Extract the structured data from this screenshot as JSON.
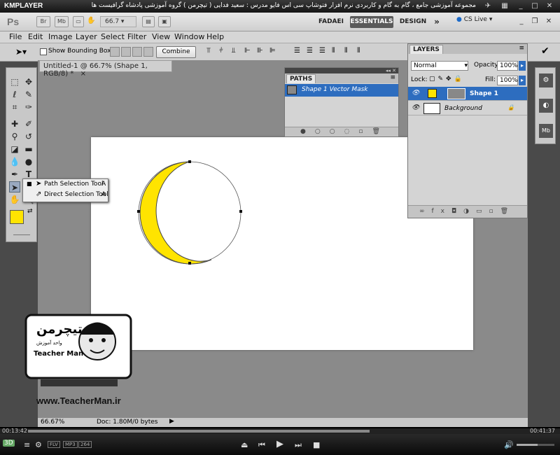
{
  "player": {
    "logo": "KMPLAYER",
    "caption": "مجموعه آموزشی جامع ، گام به گام و کاربردی نرم افزار فتوشاپ سی اس فایو   مدرس : سعید فدایی ( تیچرمن ) گروه آموزشی پادشاه گرافیست ها",
    "time_current": "00:13:42",
    "time_total": "00:41:37",
    "badge_3d": "3D",
    "formats": [
      "FLV",
      "MP3",
      "264"
    ],
    "progress": 0.65
  },
  "appbar": {
    "logo": "Ps",
    "br": "Br",
    "mb": "Mb",
    "zoom": "66.7",
    "workspaces": [
      "FADAEI",
      "ESSENTIALS",
      "DESIGN"
    ],
    "more": "»",
    "cs_live": "CS Live"
  },
  "menu": [
    "File",
    "Edit",
    "Image",
    "Layer",
    "Select",
    "Filter",
    "View",
    "Window",
    "Help"
  ],
  "options": {
    "show_bounding_box": "Show Bounding Box",
    "combine": "Combine"
  },
  "document": {
    "tab_title": "Untitled-1 @ 66.7% (Shape 1, RGB/8) *",
    "close": "×",
    "status_zoom": "66.67%",
    "status_doc": "Doc: 1.80M/0 bytes",
    "fill_color": "#ffe400"
  },
  "flyout": {
    "items": [
      {
        "label": "Path Selection Tool",
        "key": "A"
      },
      {
        "label": "Direct Selection Tool",
        "key": "A"
      }
    ]
  },
  "paths_panel": {
    "tab": "PATHS",
    "rows": [
      "Shape 1 Vector Mask"
    ]
  },
  "layers_panel": {
    "tab": "LAYERS",
    "blend_mode": "Normal",
    "opacity_label": "Opacity:",
    "opacity": "100%",
    "lock_label": "Lock:",
    "fill_label": "Fill:",
    "fill": "100%",
    "layers": [
      {
        "name": "Shape 1",
        "selected": true
      },
      {
        "name": "Background",
        "selected": false
      }
    ]
  },
  "watermark": {
    "brand_fa": "تیچرمن",
    "brand_sub": "واحد آموزش",
    "brand_en": "Teacher Man",
    "url": "www.TeacherMan.ir"
  }
}
